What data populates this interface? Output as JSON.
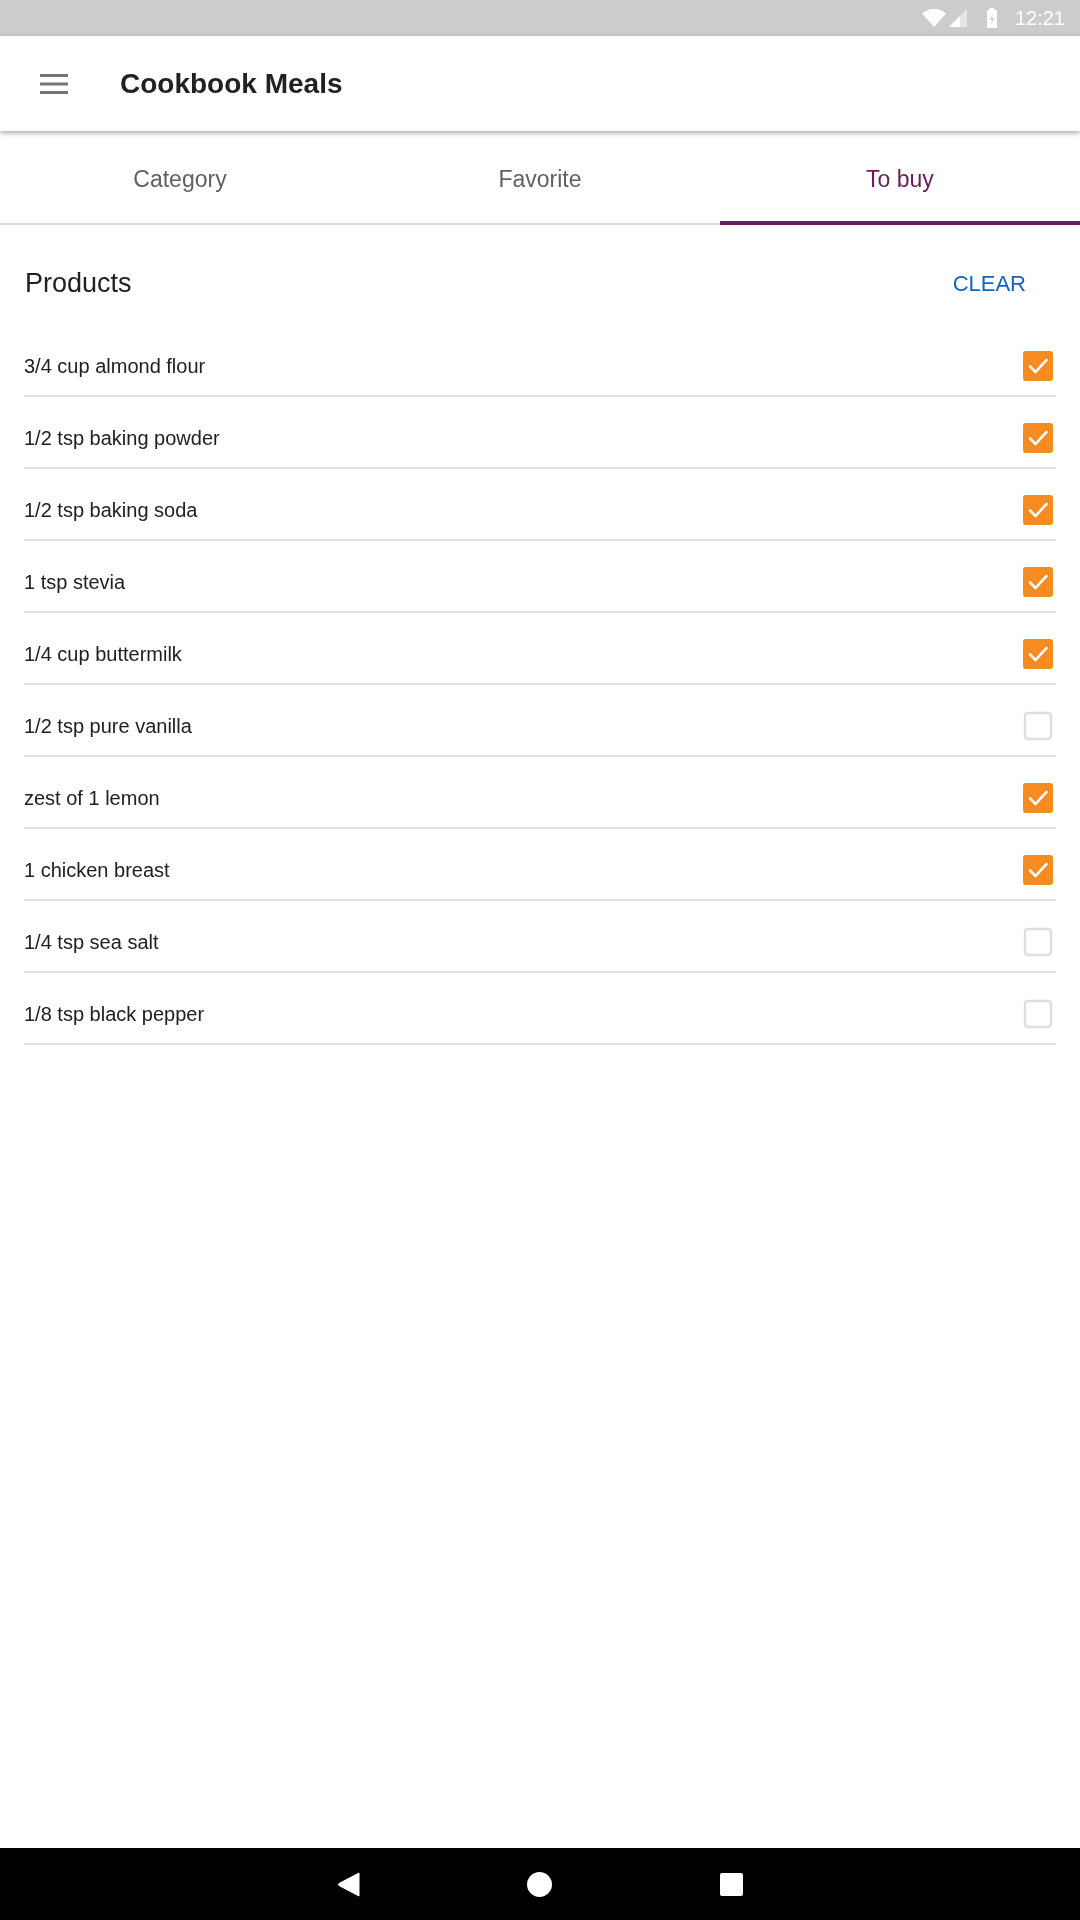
{
  "status_bar": {
    "time": "12:21"
  },
  "app_bar": {
    "title": "Cookbook Meals"
  },
  "tabs": [
    {
      "label": "Category",
      "selected": false
    },
    {
      "label": "Favorite",
      "selected": false
    },
    {
      "label": "To buy",
      "selected": true
    }
  ],
  "products": {
    "title": "Products",
    "clear_button": "CLEAR",
    "items": [
      {
        "name": "3/4 cup almond flour",
        "checked": true
      },
      {
        "name": "1/2 tsp baking powder",
        "checked": true
      },
      {
        "name": "1/2 tsp baking soda",
        "checked": true
      },
      {
        "name": "1 tsp stevia",
        "checked": true
      },
      {
        "name": "1/4 cup buttermilk",
        "checked": true
      },
      {
        "name": "1/2 tsp pure vanilla",
        "checked": false
      },
      {
        "name": "zest of 1 lemon",
        "checked": true
      },
      {
        "name": "1 chicken breast",
        "checked": true
      },
      {
        "name": "1/4 tsp sea salt",
        "checked": false
      },
      {
        "name": "1/8 tsp black pepper",
        "checked": false
      }
    ]
  }
}
